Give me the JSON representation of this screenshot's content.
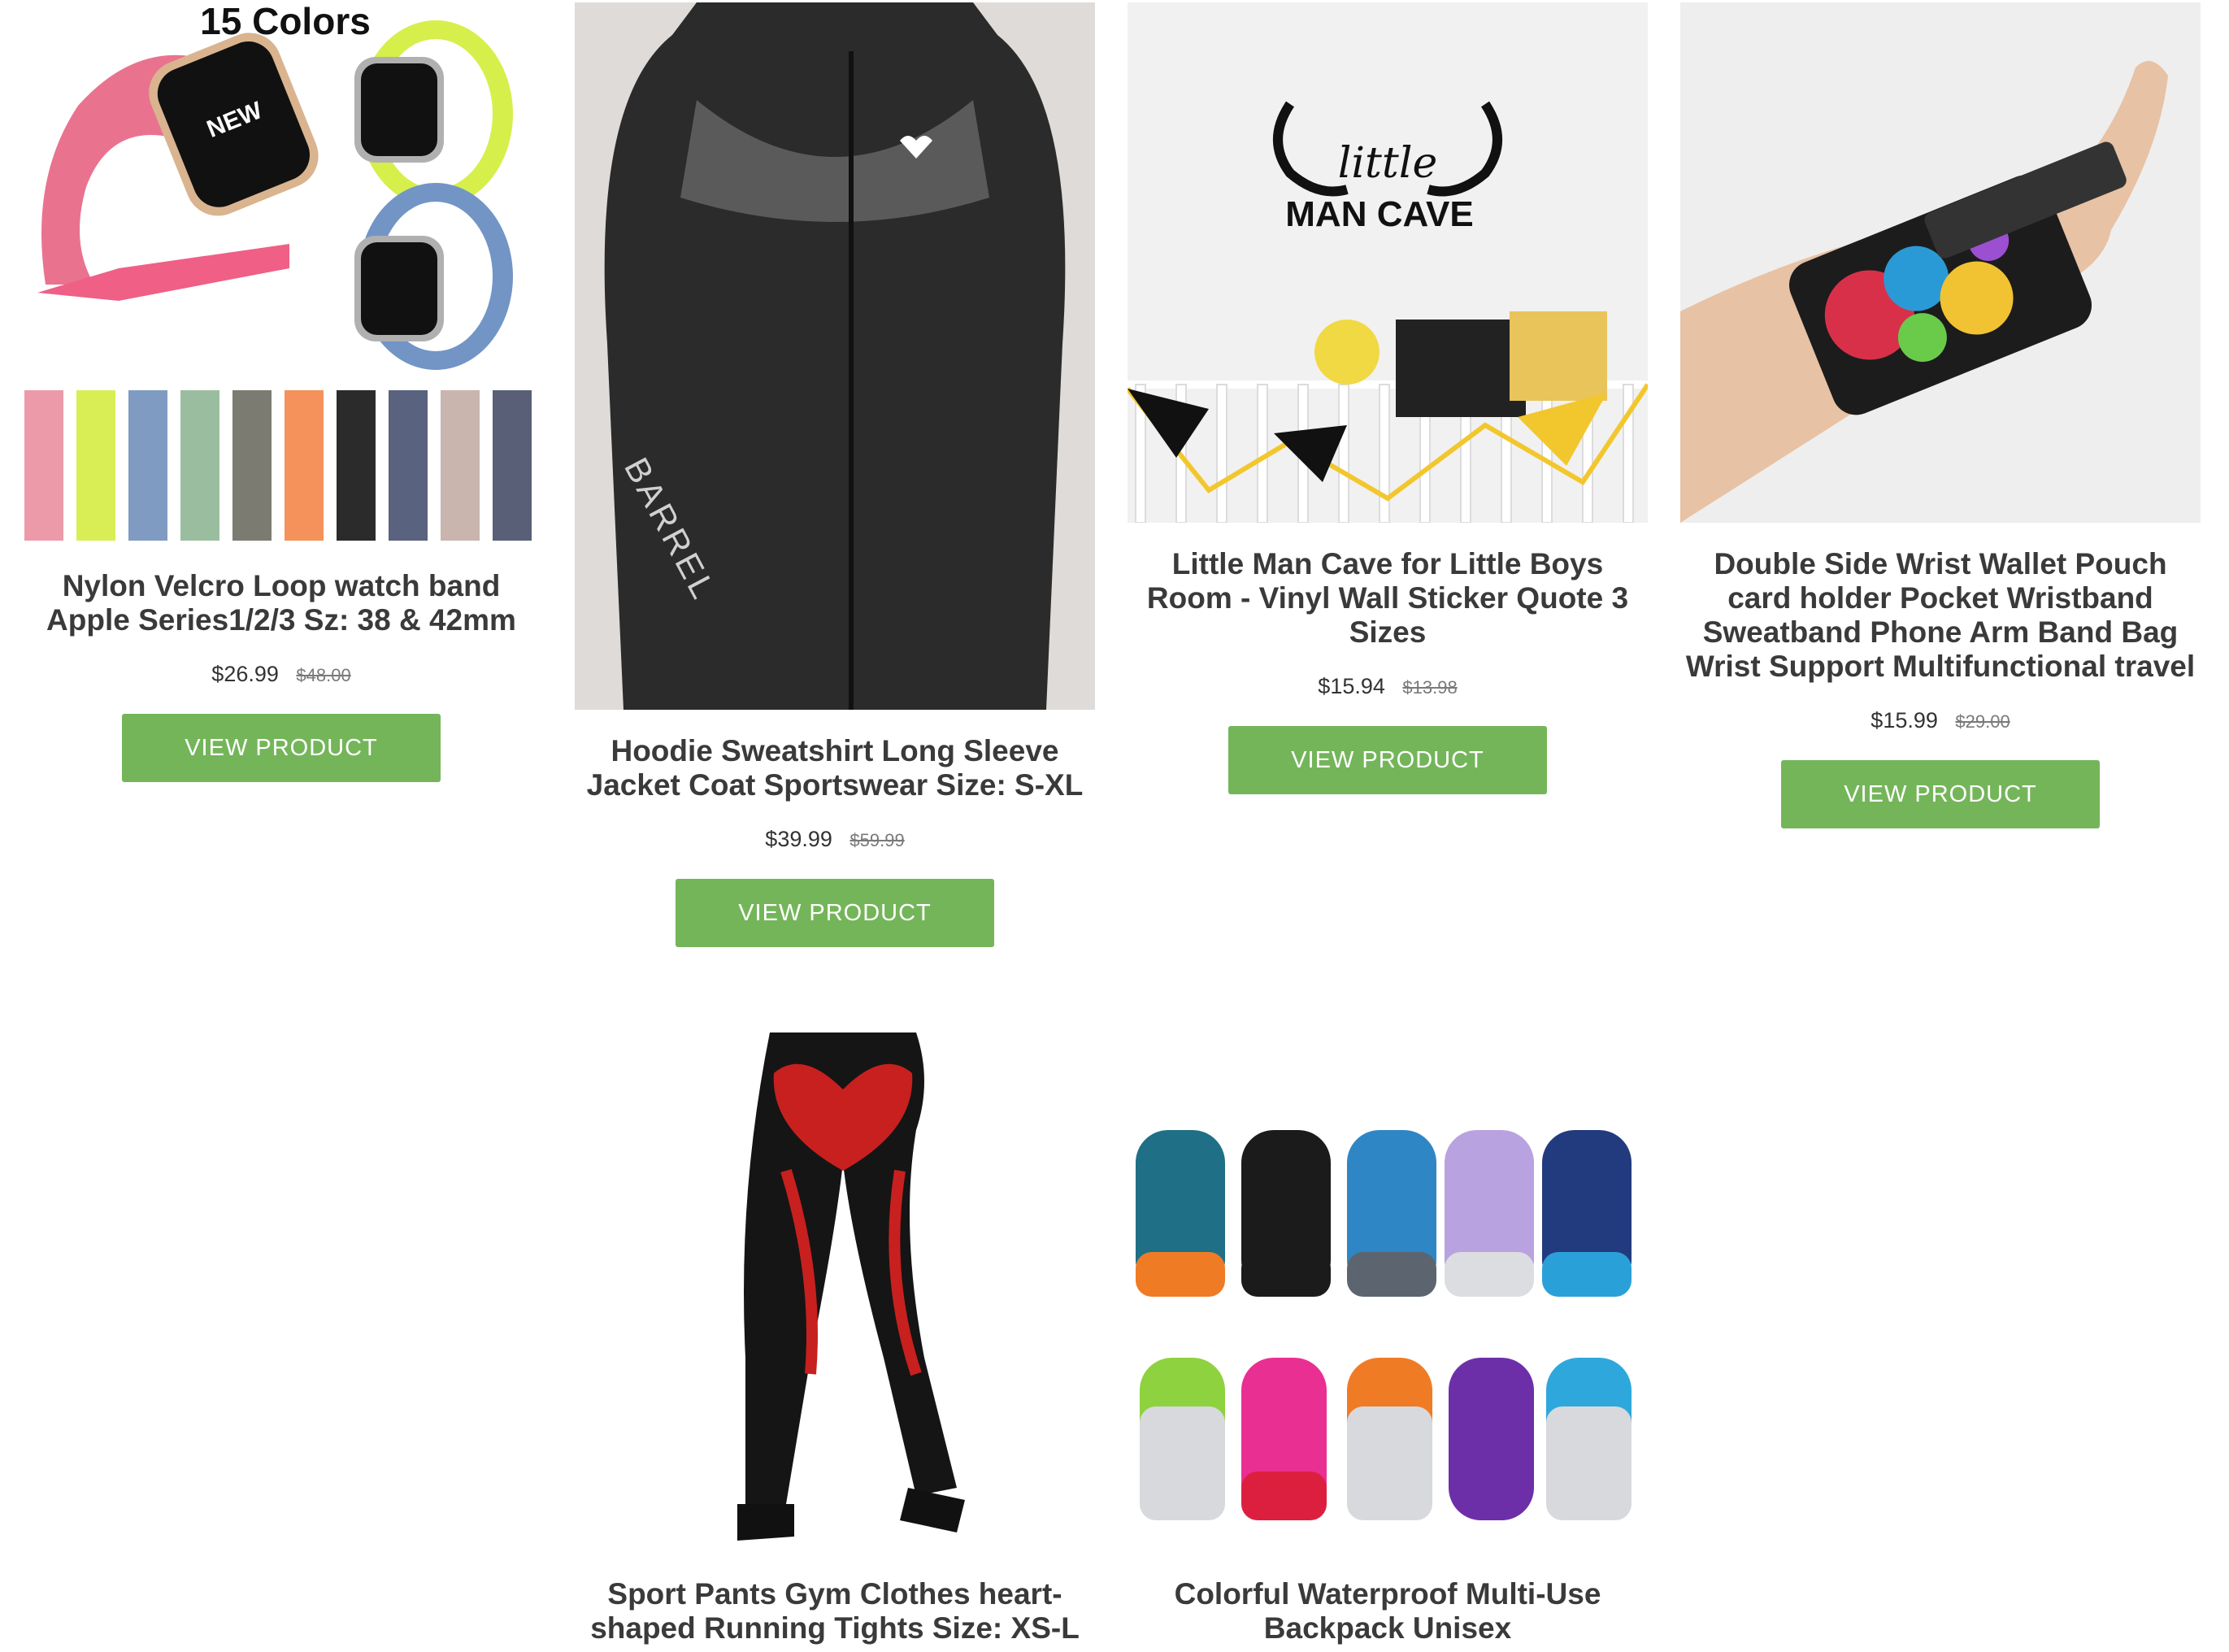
{
  "products": [
    {
      "title": "Nylon Velcro Loop watch band Apple Series1/2/3 Sz: 38 & 42mm",
      "price": "$26.99",
      "compare_price": "$48.00",
      "button": "VIEW PRODUCT",
      "image_text": "15 Colors",
      "image_badge": "NEW"
    },
    {
      "title": "Hoodie Sweatshirt Long Sleeve Jacket Coat Sportswear Size: S-XL",
      "price": "$39.99",
      "compare_price": "$59.99",
      "button": "VIEW PRODUCT",
      "image_text": "BARREL"
    },
    {
      "title": "Little Man Cave for Little Boys Room - Vinyl Wall Sticker Quote 3 Sizes",
      "price": "$15.94",
      "compare_price": "$13.98",
      "button": "VIEW PRODUCT",
      "image_text_1": "little",
      "image_text_2": "MAN CAVE"
    },
    {
      "title": "Double Side Wrist Wallet Pouch card holder Pocket Wristband Sweatband Phone Arm Band Bag Wrist Support Multifunctional travel",
      "price": "$15.99",
      "compare_price": "$29.00",
      "button": "VIEW PRODUCT"
    },
    {
      "title": "Sport Pants Gym Clothes heart-shaped Running Tights Size: XS-L"
    },
    {
      "title": "Colorful Waterproof Multi-Use Backpack Unisex"
    }
  ],
  "colors": {
    "button_bg": "#74b55a",
    "button_text": "#ffffff",
    "title_text": "#3a3a3a",
    "compare_price": "#7a7a7a"
  }
}
